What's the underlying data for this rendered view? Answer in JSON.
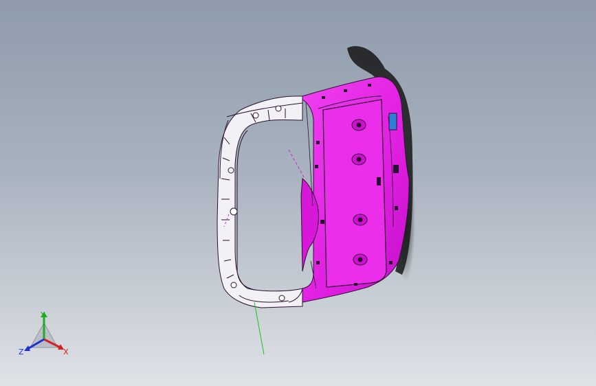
{
  "viewport": {
    "background_top": "#8e9bab",
    "background_bottom": "#dfe2e7"
  },
  "model": {
    "part_color": "#e81ee8",
    "edge_color": "#2a1030",
    "wire_color": "#f4f4f8",
    "highlight_color": "#2f7fd6"
  },
  "triad": {
    "x_label": "X",
    "y_label": "Y",
    "z_label": "Z",
    "x_color": "#d42020",
    "y_color": "#1faa1f",
    "z_color": "#2030d0"
  },
  "triad_icon": "coordinate-triad-icon"
}
